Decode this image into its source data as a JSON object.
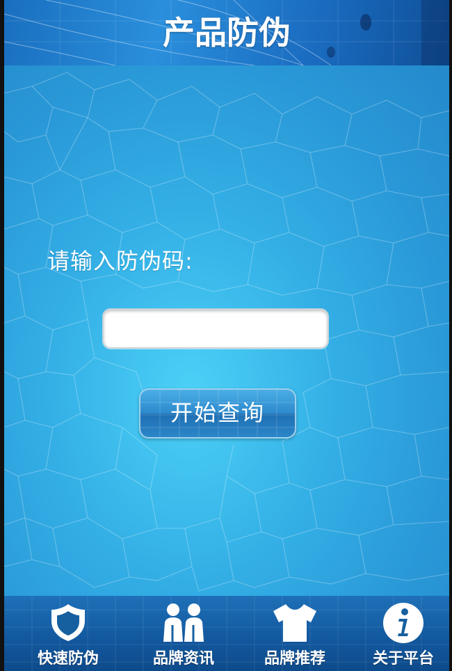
{
  "header": {
    "title": "产品防伪"
  },
  "form": {
    "prompt": "请输入防伪码:",
    "code_value": "",
    "code_placeholder": "",
    "query_label": "开始查询"
  },
  "tabs": [
    {
      "label": "快速防伪",
      "icon": "shield-icon"
    },
    {
      "label": "品牌资讯",
      "icon": "people-icon"
    },
    {
      "label": "品牌推荐",
      "icon": "shirt-icon"
    },
    {
      "label": "关于平台",
      "icon": "info-icon"
    }
  ],
  "colors": {
    "header": "#1f7fd0",
    "background": "#34b0e6",
    "tabbar": "#12579d",
    "text": "#ffffff"
  }
}
